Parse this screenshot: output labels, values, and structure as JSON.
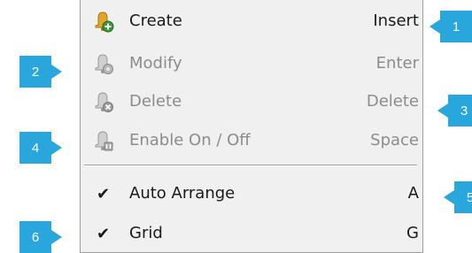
{
  "menu": {
    "items": [
      {
        "label": "Create",
        "shortcut": "Insert",
        "icon": "create-bell-icon",
        "enabled": true
      },
      {
        "label": "Modify",
        "shortcut": "Enter",
        "icon": "modify-bell-icon",
        "enabled": false
      },
      {
        "label": "Delete",
        "shortcut": "Delete",
        "icon": "delete-bell-icon",
        "enabled": false
      },
      {
        "label": "Enable On / Off",
        "shortcut": "Space",
        "icon": "enable-bell-icon",
        "enabled": false
      },
      {
        "label": "Auto Arrange",
        "shortcut": "A",
        "checked": true,
        "enabled": true
      },
      {
        "label": "Grid",
        "shortcut": "G",
        "checked": true,
        "enabled": true
      }
    ],
    "check_glyph": "✔"
  },
  "callouts": [
    "1",
    "2",
    "3",
    "4",
    "5",
    "6"
  ],
  "colors": {
    "callout": "#29a6dc",
    "menu_bg": "#f0f0f0",
    "disabled_text": "#8c8c8c",
    "icon_bell": "#e2a526",
    "icon_badge": "#3a9a3a"
  }
}
